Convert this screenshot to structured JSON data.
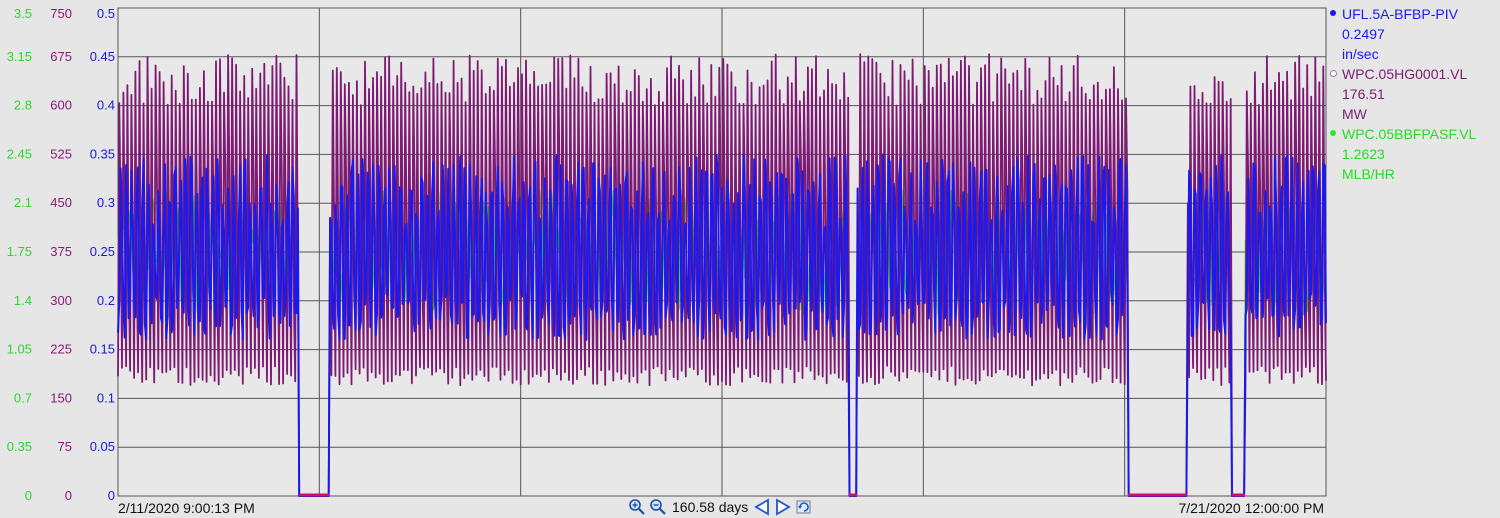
{
  "chart_data": {
    "type": "line",
    "x_range": [
      "2/11/2020 9:00:13 PM",
      "7/21/2020 12:00:00 PM"
    ],
    "duration_label": "160.58 days",
    "axes": [
      {
        "color": "#2dd62d",
        "ticks": [
          "0",
          "0.35",
          "0.7",
          "1.05",
          "1.4",
          "1.75",
          "2.1",
          "2.45",
          "2.8",
          "3.15",
          "3.5"
        ],
        "ylim": [
          0,
          3.5
        ]
      },
      {
        "color": "#8b1a7a",
        "ticks": [
          "0",
          "75",
          "150",
          "225",
          "300",
          "375",
          "450",
          "525",
          "600",
          "675",
          "750"
        ],
        "ylim": [
          0,
          750
        ]
      },
      {
        "color": "#1a1ad6",
        "ticks": [
          "0",
          "0.05",
          "0.1",
          "0.15",
          "0.2",
          "0.25",
          "0.3",
          "0.35",
          "0.4",
          "0.45",
          "0.5"
        ],
        "ylim": [
          0,
          0.5
        ]
      }
    ],
    "series": [
      {
        "name": "UFL.5A-BFBP-PIV",
        "value": "0.2497",
        "unit": "in/sec",
        "color": "#1a1aee"
      },
      {
        "name": "WPC.05HG0001.VL",
        "value": "176.51",
        "unit": "MW",
        "color": "#7d1a73"
      },
      {
        "name": "WPC.05BBFPASF.VL",
        "value": "1.2623",
        "unit": "MLB/HR",
        "color": "#22ee22"
      }
    ],
    "gaps": [
      [
        0.15,
        0.175
      ],
      [
        0.605,
        0.612
      ],
      [
        0.836,
        0.885
      ],
      [
        0.922,
        0.933
      ]
    ],
    "grid": true
  },
  "legend": [
    {
      "name": "UFL.5A-BFBP-PIV",
      "value": "0.2497",
      "unit": "in/sec",
      "color": "#1a1aee",
      "hollow": false
    },
    {
      "name": "WPC.05HG0001.VL",
      "value": "176.51",
      "unit": "MW",
      "color": "#7d1a73",
      "hollow": true
    },
    {
      "name": "WPC.05BBFPASF.VL",
      "value": "1.2623",
      "unit": "MLB/HR",
      "color": "#22ee22",
      "hollow": false
    }
  ],
  "footer": {
    "start": "2/11/2020 9:00:13 PM",
    "end": "7/21/2020 12:00:00 PM",
    "duration": "160.58 days"
  },
  "icons": {
    "zoom_in": "zoom-in-icon",
    "zoom_out": "zoom-out-icon",
    "scroll_left": "arrow-left-icon",
    "scroll_right": "arrow-right-icon",
    "refresh": "refresh-icon"
  }
}
